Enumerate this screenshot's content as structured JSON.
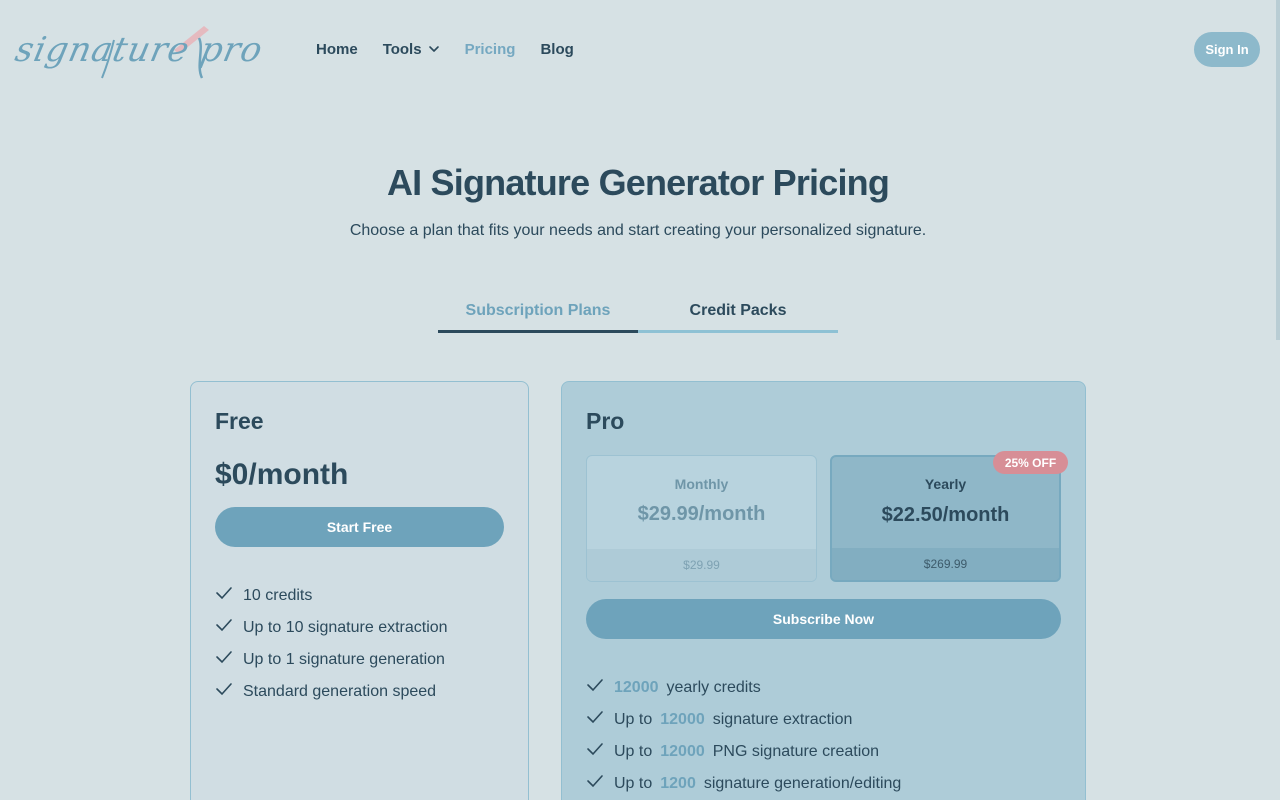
{
  "brand": {
    "logo_text": "signature pro"
  },
  "nav": {
    "items": [
      {
        "label": "Home"
      },
      {
        "label": "Tools"
      },
      {
        "label": "Pricing"
      },
      {
        "label": "Blog"
      }
    ],
    "active": "Pricing",
    "signin_label": "Sign In"
  },
  "hero": {
    "title": "AI Signature Generator Pricing",
    "subtitle": "Choose a plan that fits your needs and start creating your personalized signature."
  },
  "tabs": [
    {
      "label": "Subscription Plans",
      "active": true
    },
    {
      "label": "Credit Packs",
      "active": false
    }
  ],
  "plans": {
    "free": {
      "name": "Free",
      "price": "$0/month",
      "button": "Start Free",
      "features": [
        "10 credits",
        "Up to 10 signature extraction",
        "Up to 1 signature generation",
        "Standard generation speed"
      ]
    },
    "pro": {
      "name": "Pro",
      "monthly": {
        "label": "Monthly",
        "price": "$29.99/month",
        "total": "$29.99"
      },
      "yearly": {
        "label": "Yearly",
        "price": "$22.50/month",
        "total": "$269.99",
        "badge": "25% OFF",
        "selected": true
      },
      "button": "Subscribe Now",
      "features": [
        {
          "prefix": "",
          "value": "12000",
          "suffix": "yearly credits"
        },
        {
          "prefix": "Up to",
          "value": "12000",
          "suffix": "signature extraction"
        },
        {
          "prefix": "Up to",
          "value": "12000",
          "suffix": "PNG signature creation"
        },
        {
          "prefix": "Up to",
          "value": "1200",
          "suffix": "signature generation/editing"
        }
      ]
    }
  },
  "colors": {
    "background": "#d6e1e4",
    "accent": "#6ea3bb",
    "text": "#2c4a5c",
    "badge": "#d78e96"
  },
  "icons": {
    "dropdown": "chevron-down-icon",
    "feature": "check-icon"
  }
}
